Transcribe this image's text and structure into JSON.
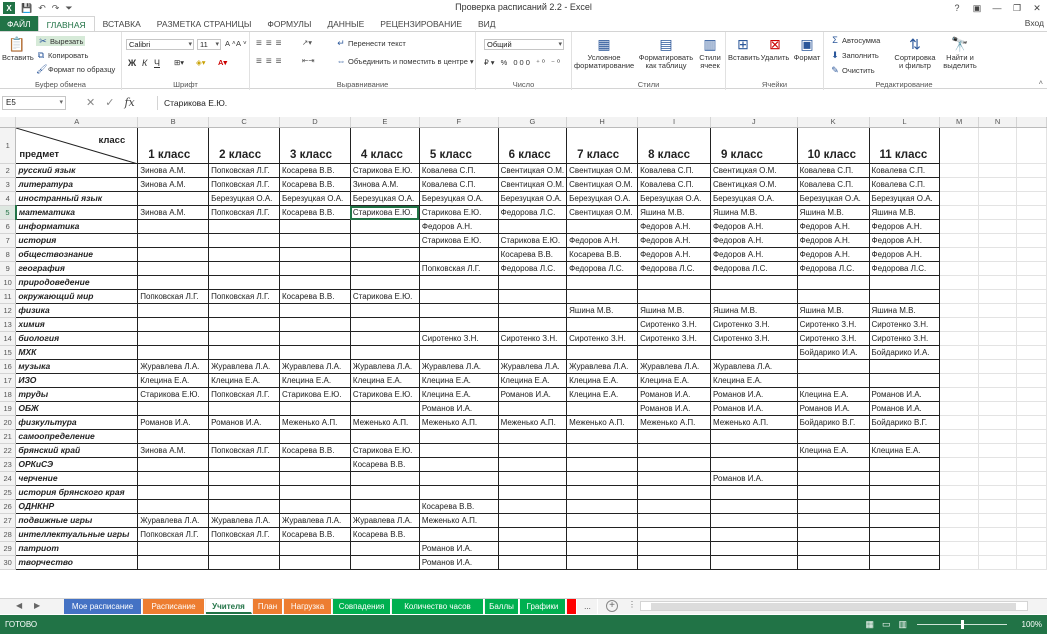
{
  "titlebar": {
    "title": "Проверка расписаний 2.2 - Excel",
    "logo": "X",
    "sign_in": "Вход"
  },
  "ribbon_tabs": [
    "ФАЙЛ",
    "ГЛАВНАЯ",
    "ВСТАВКА",
    "РАЗМЕТКА СТРАНИЦЫ",
    "ФОРМУЛЫ",
    "ДАННЫЕ",
    "РЕЦЕНЗИРОВАНИЕ",
    "ВИД"
  ],
  "ribbon": {
    "clipboard": {
      "paste": "Вставить",
      "cut": "Вырезать",
      "copy": "Копировать",
      "format_painter": "Формат по образцу",
      "label": "Буфер обмена"
    },
    "font": {
      "name": "Calibri",
      "size": "11",
      "bold": "Ж",
      "italic": "К",
      "underline": "Ч",
      "label": "Шрифт"
    },
    "alignment": {
      "wrap": "Перенести текст",
      "merge": "Объединить и поместить в центре",
      "label": "Выравнивание"
    },
    "number": {
      "format": "Общий",
      "label": "Число"
    },
    "styles": {
      "conditional": "Условное форматирование",
      "as_table": "Форматировать как таблицу",
      "cell_styles": "Стили ячеек",
      "label": "Стили"
    },
    "cells": {
      "insert": "Вставить",
      "delete": "Удалить",
      "format": "Формат",
      "label": "Ячейки"
    },
    "editing": {
      "autosum": "Автосумма",
      "fill": "Заполнить",
      "clear": "Очистить",
      "sort": "Сортировка и фильтр",
      "find": "Найти и выделить",
      "label": "Редактирование"
    }
  },
  "formula_bar": {
    "name_box": "E5",
    "fx": "fx",
    "value": "Старикова Е.Ю."
  },
  "columns": [
    "A",
    "B",
    "C",
    "D",
    "E",
    "F",
    "G",
    "H",
    "I",
    "J",
    "K",
    "L",
    "M",
    "N"
  ],
  "header": {
    "class_word": "класс",
    "subject_word": "предмет",
    "classes": [
      "1 класс",
      "2 класс",
      "3 класс",
      "4 класс",
      "5 класс",
      "6 класс",
      "7 класс",
      "8 класс",
      "9 класс",
      "10 класс",
      "11 класс"
    ]
  },
  "rows": [
    [
      "русский язык",
      "Зинова А.М.",
      "Попковская Л.Г.",
      "Косарева В.В.",
      "Старикова Е.Ю.",
      "Ковалева С.П.",
      "Свентицкая О.М.",
      "Свентицкая О.М.",
      "Ковалева С.П.",
      "Свентицкая О.М.",
      "Ковалева С.П.",
      "Ковалева С.П."
    ],
    [
      "литература",
      "Зинова А.М.",
      "Попковская Л.Г.",
      "Косарева В.В.",
      "Зинова А.М.",
      "Ковалева С.П.",
      "Свентицкая О.М.",
      "Свентицкая О.М.",
      "Ковалева С.П.",
      "Свентицкая О.М.",
      "Ковалева С.П.",
      "Ковалева С.П."
    ],
    [
      "иностранный язык",
      "",
      "Березуцкая О.А.",
      "Березуцкая О.А.",
      "Березуцкая О.А.",
      "Березуцкая О.А.",
      "Березуцкая О.А.",
      "Березуцкая О.А.",
      "Березуцкая О.А.",
      "Березуцкая О.А.",
      "Березуцкая О.А.",
      "Березуцкая О.А."
    ],
    [
      "математика",
      "Зинова А.М.",
      "Попковская Л.Г.",
      "Косарева В.В.",
      "Старикова Е.Ю.",
      "Старикова Е.Ю.",
      "Федорова Л.С.",
      "Свентицкая О.М.",
      "Яшина М.В.",
      "Яшина М.В.",
      "Яшина М.В.",
      "Яшина М.В."
    ],
    [
      "информатика",
      "",
      "",
      "",
      "",
      "Федоров А.Н.",
      "",
      "",
      "Федоров А.Н.",
      "Федоров А.Н.",
      "Федоров А.Н.",
      "Федоров А.Н."
    ],
    [
      "история",
      "",
      "",
      "",
      "",
      "Старикова Е.Ю.",
      "Старикова Е.Ю.",
      "Федоров А.Н.",
      "Федоров А.Н.",
      "Федоров А.Н.",
      "Федоров А.Н.",
      "Федоров А.Н."
    ],
    [
      "обществознание",
      "",
      "",
      "",
      "",
      "",
      "Косарева В.В.",
      "Косарева В.В.",
      "Федоров А.Н.",
      "Федоров А.Н.",
      "Федоров А.Н.",
      "Федоров А.Н."
    ],
    [
      "география",
      "",
      "",
      "",
      "",
      "Попковская Л.Г.",
      "Федорова Л.С.",
      "Федорова Л.С.",
      "Федорова Л.С.",
      "Федорова Л.С.",
      "Федорова Л.С.",
      "Федорова Л.С."
    ],
    [
      "природоведение",
      "",
      "",
      "",
      "",
      "",
      "",
      "",
      "",
      "",
      "",
      ""
    ],
    [
      "окружающий мир",
      "Попковская Л.Г.",
      "Попковская Л.Г.",
      "Косарева В.В.",
      "Старикова Е.Ю.",
      "",
      "",
      "",
      "",
      "",
      "",
      ""
    ],
    [
      "физика",
      "",
      "",
      "",
      "",
      "",
      "",
      "Яшина М.В.",
      "Яшина М.В.",
      "Яшина М.В.",
      "Яшина М.В.",
      "Яшина М.В."
    ],
    [
      "химия",
      "",
      "",
      "",
      "",
      "",
      "",
      "",
      "Сиротенко З.Н.",
      "Сиротенко З.Н.",
      "Сиротенко З.Н.",
      "Сиротенко З.Н."
    ],
    [
      "биология",
      "",
      "",
      "",
      "",
      "Сиротенко З.Н.",
      "Сиротенко З.Н.",
      "Сиротенко З.Н.",
      "Сиротенко З.Н.",
      "Сиротенко З.Н.",
      "Сиротенко З.Н.",
      "Сиротенко З.Н."
    ],
    [
      "МХК",
      "",
      "",
      "",
      "",
      "",
      "",
      "",
      "",
      "",
      "Бойдарико И.А.",
      "Бойдарико И.А."
    ],
    [
      "музыка",
      "Журавлева Л.А.",
      "Журавлева Л.А.",
      "Журавлева Л.А.",
      "Журавлева Л.А.",
      "Журавлева Л.А.",
      "Журавлева Л.А.",
      "Журавлева Л.А.",
      "Журавлева Л.А.",
      "Журавлева Л.А.",
      "",
      ""
    ],
    [
      "ИЗО",
      "Клецина Е.А.",
      "Клецина Е.А.",
      "Клецина Е.А.",
      "Клецина Е.А.",
      "Клецина Е.А.",
      "Клецина Е.А.",
      "Клецина Е.А.",
      "Клецина Е.А.",
      "Клецина Е.А.",
      "",
      ""
    ],
    [
      "труды",
      "Старикова Е.Ю.",
      "Попковская Л.Г.",
      "Старикова Е.Ю.",
      "Старикова Е.Ю.",
      "Клецина Е.А.",
      "Романов И.А.",
      "Клецина Е.А.",
      "Романов И.А.",
      "Романов И.А.",
      "Клецина Е.А.",
      "Романов И.А."
    ],
    [
      "ОБЖ",
      "",
      "",
      "",
      "",
      "Романов И.А.",
      "",
      "",
      "Романов И.А.",
      "Романов И.А.",
      "Романов И.А.",
      "Романов И.А."
    ],
    [
      "физкультура",
      "Романов И.А.",
      "Романов И.А.",
      "Меженько А.П.",
      "Меженько А.П.",
      "Меженько А.П.",
      "Меженько А.П.",
      "Меженько А.П.",
      "Меженько А.П.",
      "Меженько А.П.",
      "Бойдарико В.Г.",
      "Бойдарико В.Г."
    ],
    [
      "самоопределение",
      "",
      "",
      "",
      "",
      "",
      "",
      "",
      "",
      "",
      "",
      ""
    ],
    [
      "брянский край",
      "Зинова А.М.",
      "Попковская Л.Г.",
      "Косарева В.В.",
      "Старикова Е.Ю.",
      "",
      "",
      "",
      "",
      "",
      "Клецина Е.А.",
      "Клецина Е.А."
    ],
    [
      "ОРКиСЭ",
      "",
      "",
      "",
      "Косарева В.В.",
      "",
      "",
      "",
      "",
      "",
      "",
      ""
    ],
    [
      "черчение",
      "",
      "",
      "",
      "",
      "",
      "",
      "",
      "",
      "Романов И.А.",
      "",
      ""
    ],
    [
      "история брянского края",
      "",
      "",
      "",
      "",
      "",
      "",
      "",
      "",
      "",
      "",
      ""
    ],
    [
      "ОДНКНР",
      "",
      "",
      "",
      "",
      "Косарева В.В.",
      "",
      "",
      "",
      "",
      "",
      ""
    ],
    [
      "подвижные игры",
      "Журавлева Л.А.",
      "Журавлева Л.А.",
      "Журавлева Л.А.",
      "Журавлева Л.А.",
      "Меженько А.П.",
      "",
      "",
      "",
      "",
      "",
      ""
    ],
    [
      "интеллектуальные игры",
      "Попковская Л.Г.",
      "Попковская Л.Г.",
      "Косарева В.В.",
      "Косарева В.В.",
      "",
      "",
      "",
      "",
      "",
      "",
      ""
    ],
    [
      "патриот",
      "",
      "",
      "",
      "",
      "Романов И.А.",
      "",
      "",
      "",
      "",
      "",
      ""
    ],
    [
      "творчество",
      "",
      "",
      "",
      "",
      "Романов И.А.",
      "",
      "",
      "",
      "",
      "",
      ""
    ]
  ],
  "sheet_tabs": [
    {
      "name": "Мое расписание",
      "color": "#4472c4"
    },
    {
      "name": "Расписание",
      "color": "#ed7d31"
    },
    {
      "name": "Учителя",
      "color": "#ffffff"
    },
    {
      "name": "План",
      "color": "#ed7d31"
    },
    {
      "name": "Нагрузка",
      "color": "#ed7d31"
    },
    {
      "name": "Совпадения",
      "color": "#00b050"
    },
    {
      "name": "Количество часов",
      "color": "#00b050"
    },
    {
      "name": "Баллы",
      "color": "#00b050"
    },
    {
      "name": "Графики",
      "color": "#00b050"
    },
    {
      "name": "",
      "color": "#ff0000"
    },
    {
      "name": "...",
      "color": "#f3f3f3"
    }
  ],
  "status": {
    "ready": "ГОТОВО",
    "zoom": "100%"
  }
}
